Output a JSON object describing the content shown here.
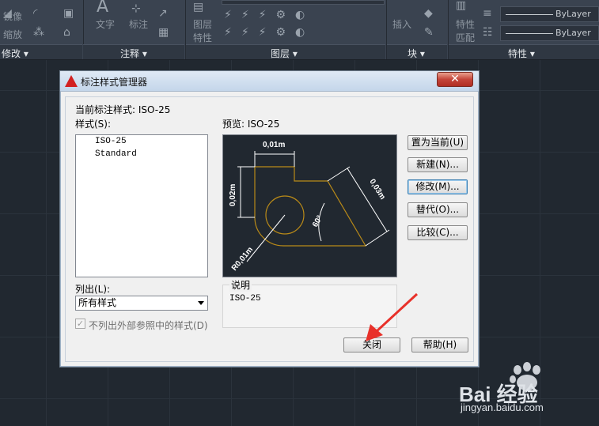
{
  "ribbon": {
    "tool_labels": {
      "mirror": "镜像",
      "scale": "缩放",
      "text": "文字",
      "dimension": "标注",
      "insert": "插入",
      "match_properties_1": "特性",
      "match_properties_2": "匹配",
      "layer_props_1": "图层",
      "layer_props_2": "特性"
    },
    "panels": {
      "modify": "修改 ▾",
      "annotation": "注释 ▾",
      "layers": "图层 ▾",
      "block": "块 ▾",
      "properties": "特性 ▾"
    },
    "bylayer_1": "ByLayer",
    "bylayer_2": "ByLayer"
  },
  "dialog": {
    "title": "标注样式管理器",
    "close_glyph": "✕",
    "current_style_label": "当前标注样式: ISO-25",
    "styles_label": "样式(S):",
    "styles": [
      "ISO-25",
      "Standard"
    ],
    "preview_label": "预览: ISO-25",
    "list_label": "列出(L):",
    "list_value": "所有样式",
    "exclude_xref_label": "不列出外部参照中的样式(D)",
    "exclude_xref_checked": true,
    "description_label": "说明",
    "description_value": "ISO-25",
    "buttons": {
      "set_current": "置为当前(U)",
      "new": "新建(N)...",
      "modify": "修改(M)...",
      "override": "替代(O)...",
      "compare": "比较(C)...",
      "close": "关闭",
      "help": "帮助(H)"
    },
    "preview_dims": {
      "top": "0,01m",
      "left": "0,02m",
      "right": "0,03m",
      "angle": "60°",
      "radius": "R0,01m"
    }
  },
  "watermark": {
    "brand": "Bai 经验",
    "url": "jingyan.baidu.com"
  },
  "colors": {
    "accent_arrow": "#e8312a",
    "geometry": "#b98a18",
    "dim_lines": "#ffffff"
  }
}
